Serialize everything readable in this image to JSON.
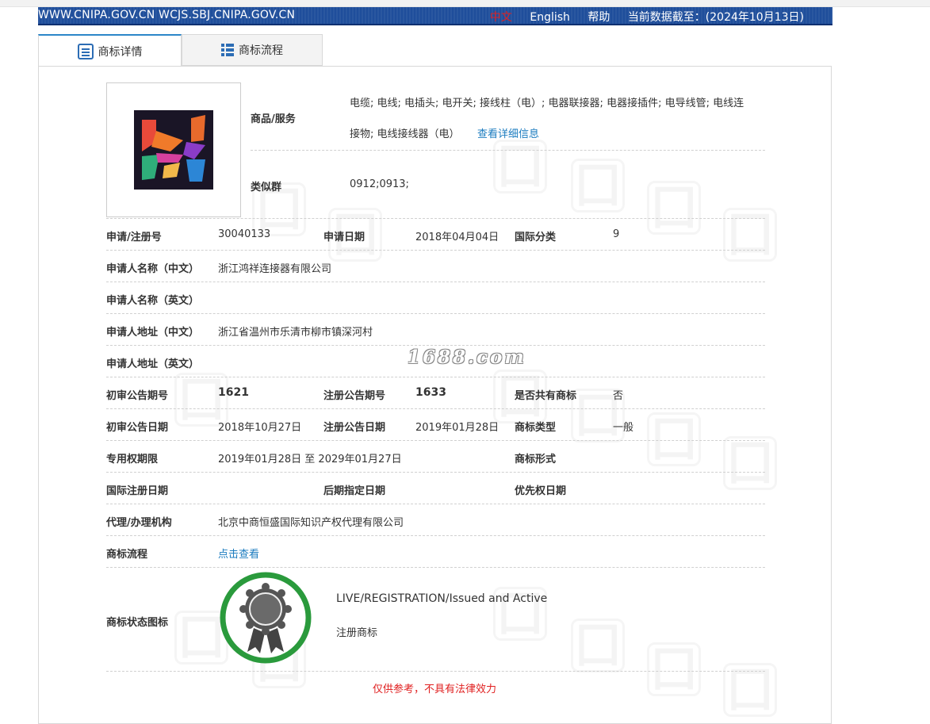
{
  "topbar": {
    "site": "WWW.CNIPA.GOV.CN WCJS.SBJ.CNIPA.GOV.CN",
    "lang_zh": "中文",
    "lang_en": "English",
    "help": "帮助",
    "data_date": "当前数据截至：(2024年10月13日)"
  },
  "tabs": [
    {
      "label": "商标详情",
      "icon": "document-list-icon",
      "active": true
    },
    {
      "label": "商标流程",
      "icon": "grid-list-icon",
      "active": false
    }
  ],
  "detail": {
    "goods_label": "商品/服务",
    "goods_line1": "电缆; 电线; 电插头; 电开关; 接线柱（电）; 电器联接器; 电器接插件; 电导线管; 电线连",
    "goods_line2": "接物; 电线接线器（电）",
    "goods_link": "查看详细信息",
    "similar_label": "类似群",
    "similar_value": "0912;0913;",
    "reg_no_label": "申请/注册号",
    "reg_no": "30040133",
    "app_date_label": "申请日期",
    "app_date": "2018年04月04日",
    "intl_class_label": "国际分类",
    "intl_class": "9",
    "applicant_cn_label": "申请人名称（中文）",
    "applicant_cn": "浙江鸿祥连接器有限公司",
    "applicant_en_label": "申请人名称（英文）",
    "applicant_en": "",
    "address_cn_label": "申请人地址（中文）",
    "address_cn": "浙江省温州市乐清市柳市镇深河村",
    "address_en_label": "申请人地址（英文）",
    "address_en": "",
    "prelim_no_label": "初审公告期号",
    "prelim_no": "1621",
    "reg_pub_no_label": "注册公告期号",
    "reg_pub_no": "1633",
    "shared_label": "是否共有商标",
    "shared": "否",
    "prelim_date_label": "初审公告日期",
    "prelim_date": "2018年10月27日",
    "reg_pub_date_label": "注册公告日期",
    "reg_pub_date": "2019年01月28日",
    "tm_type_label": "商标类型",
    "tm_type": "一般",
    "term_label": "专用权期限",
    "term": "2019年01月28日 至 2029年01月27日",
    "tm_form_label": "商标形式",
    "tm_form": "",
    "intl_reg_date_label": "国际注册日期",
    "intl_reg_date": "",
    "later_date_label": "后期指定日期",
    "later_date": "",
    "priority_date_label": "优先权日期",
    "priority_date": "",
    "agent_label": "代理/办理机构",
    "agent": "北京中商恒盛国际知识产权代理有限公司",
    "process_label": "商标流程",
    "process_link": "点击查看",
    "status_label": "商标状态图标",
    "status_en": "LIVE/REGISTRATION/Issued and Active",
    "status_cn": "注册商标"
  },
  "watermark_overlay": "1688.com",
  "disclaimer": "仅供参考，不具有法律效力",
  "colors": {
    "topbar": "#1f4e9b",
    "link": "#1a7bbf",
    "disclaimer": "#e02020",
    "status_ring": "#2a9a3c"
  }
}
